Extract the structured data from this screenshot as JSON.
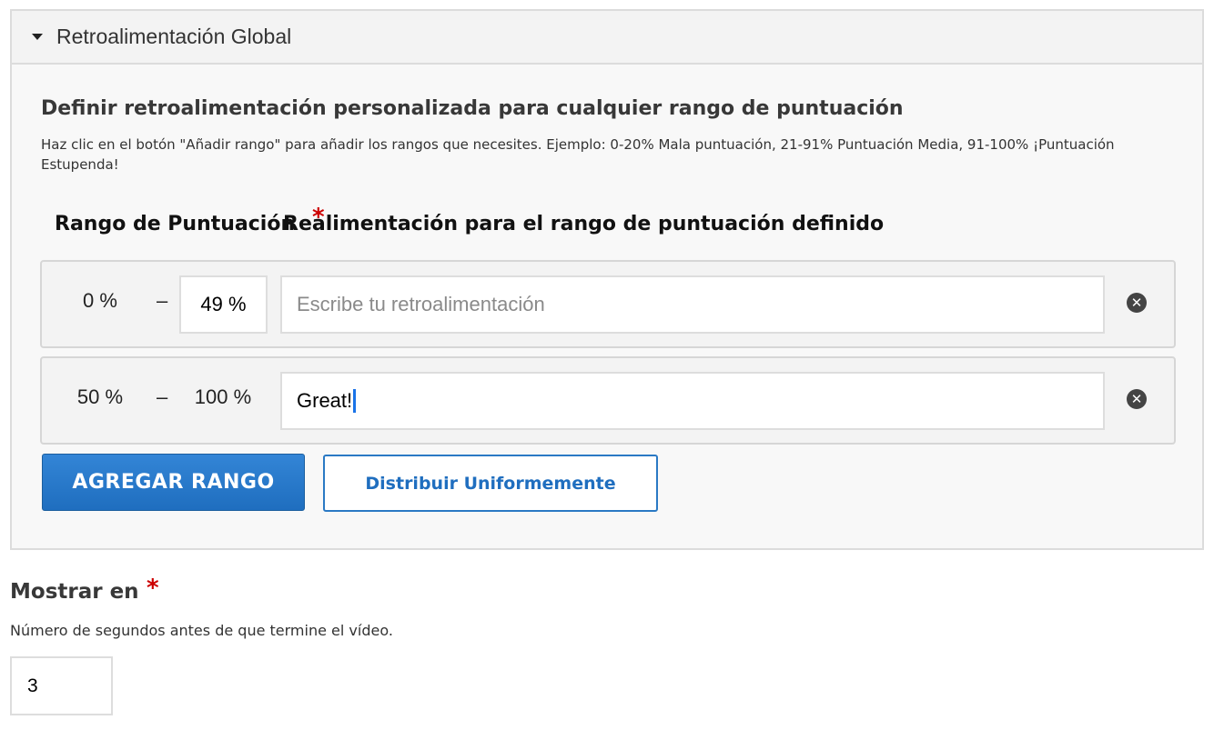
{
  "panel": {
    "title": "Retroalimentación Global"
  },
  "section": {
    "title": "Definir retroalimentación personalizada para cualquier rango de puntuación",
    "description": "Haz clic en el botón \"Añadir rango\" para añadir los rangos que necesites. Ejemplo: 0-20% Mala puntuación, 21-91% Puntuación Media, 91-100% ¡Puntuación Estupenda!"
  },
  "columns": {
    "range": "Rango de Puntuación",
    "feedback": "Realimentación para el rango de puntuación definido",
    "required_mark": "*"
  },
  "ranges": [
    {
      "from": "0 %",
      "separator": "–",
      "to": "49 %",
      "feedback_value": "",
      "feedback_placeholder": "Escribe tu retroalimentación"
    },
    {
      "from": "50 %",
      "separator": "–",
      "to": "100 %",
      "feedback_value": "Great!",
      "feedback_placeholder": ""
    }
  ],
  "buttons": {
    "add_range": "AGREGAR RANGO",
    "distribute": "Distribuir Uniformemente",
    "remove": "✕"
  },
  "show_at": {
    "label": "Mostrar en",
    "required_mark": "*",
    "description": "Número de segundos antes de que termine el vídeo.",
    "value": "3"
  },
  "colors": {
    "primary": "#2a79c4",
    "required": "#cc0000"
  }
}
